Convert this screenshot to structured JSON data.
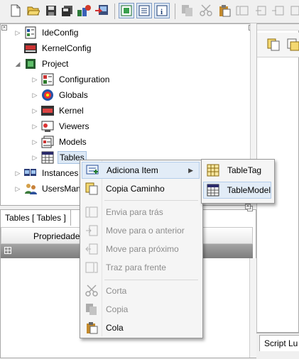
{
  "toolbar": {
    "buttons": [
      {
        "icon": "new-file-icon",
        "pressed": false,
        "disabled": false
      },
      {
        "icon": "open-folder-icon",
        "pressed": false,
        "disabled": false
      },
      {
        "icon": "save-icon",
        "pressed": false,
        "disabled": false
      },
      {
        "icon": "save-all-icon",
        "pressed": false,
        "disabled": false
      },
      {
        "icon": "build-icon",
        "pressed": false,
        "disabled": false
      },
      {
        "icon": "deploy-icon",
        "pressed": false,
        "disabled": false
      },
      {
        "icon": "toggle-tree-icon",
        "pressed": true,
        "disabled": false
      },
      {
        "icon": "toggle-list-icon",
        "pressed": true,
        "disabled": false
      },
      {
        "icon": "info-icon",
        "pressed": true,
        "disabled": false
      },
      {
        "icon": "copy-icon",
        "pressed": false,
        "disabled": true
      },
      {
        "icon": "cut-icon",
        "pressed": false,
        "disabled": true
      },
      {
        "icon": "paste-icon",
        "pressed": false,
        "disabled": false
      },
      {
        "icon": "bring-forward-icon",
        "pressed": false,
        "disabled": true
      },
      {
        "icon": "send-backward-icon",
        "pressed": false,
        "disabled": true
      }
    ]
  },
  "tree": {
    "nodes": [
      {
        "label": "IdeConfig",
        "icon": "config-icon",
        "level": 0,
        "expanded": false
      },
      {
        "label": "KernelConfig",
        "icon": "kernel-config-icon",
        "level": 0,
        "expanded": null
      },
      {
        "label": "Project",
        "icon": "project-icon",
        "level": 0,
        "expanded": true
      },
      {
        "label": "Configuration",
        "icon": "configuration-icon",
        "level": 1,
        "expanded": false
      },
      {
        "label": "Globals",
        "icon": "globals-icon",
        "level": 1,
        "expanded": false
      },
      {
        "label": "Kernel",
        "icon": "kernel-icon",
        "level": 1,
        "expanded": false
      },
      {
        "label": "Viewers",
        "icon": "viewers-icon",
        "level": 1,
        "expanded": false
      },
      {
        "label": "Models",
        "icon": "models-icon",
        "level": 1,
        "expanded": false
      },
      {
        "label": "Tables",
        "icon": "tables-icon",
        "level": 1,
        "expanded": false,
        "selected": true
      },
      {
        "label": "Instances",
        "icon": "instances-icon",
        "level": 0,
        "expanded": false
      },
      {
        "label": "UsersMan",
        "icon": "users-icon",
        "level": 0,
        "expanded": false
      }
    ]
  },
  "tables_panel": {
    "tab_label": "Tables [ Tables ]",
    "column_header": "Propriedade"
  },
  "right_bottom_tab": "Script Lu",
  "context_menu": {
    "items": [
      {
        "label": "Adiciona Item",
        "icon": "add-item-icon",
        "disabled": false,
        "submenu": true,
        "highlighted": true
      },
      {
        "label": "Copia Caminho",
        "icon": "copy-path-icon",
        "disabled": false
      },
      {
        "label": "Envia para trás",
        "icon": "send-to-back-icon",
        "disabled": true
      },
      {
        "label": "Move para o anterior",
        "icon": "move-previous-icon",
        "disabled": true
      },
      {
        "label": "Move para próximo",
        "icon": "move-next-icon",
        "disabled": true
      },
      {
        "label": "Traz para frente",
        "icon": "bring-to-front-icon",
        "disabled": true
      },
      {
        "label": "Corta",
        "icon": "cut-icon",
        "disabled": true
      },
      {
        "label": "Copia",
        "icon": "copy-icon",
        "disabled": true
      },
      {
        "label": "Cola",
        "icon": "paste-icon",
        "disabled": false
      }
    ]
  },
  "submenu": {
    "items": [
      {
        "label": "TableTag",
        "icon": "table-tag-icon",
        "highlighted": false
      },
      {
        "label": "TableModel",
        "icon": "table-model-icon",
        "highlighted": true
      }
    ]
  },
  "colors": {
    "highlight_bg": "#e2ecf7",
    "highlight_border": "#b4cdea",
    "disabled_text": "#8d8d8d"
  }
}
